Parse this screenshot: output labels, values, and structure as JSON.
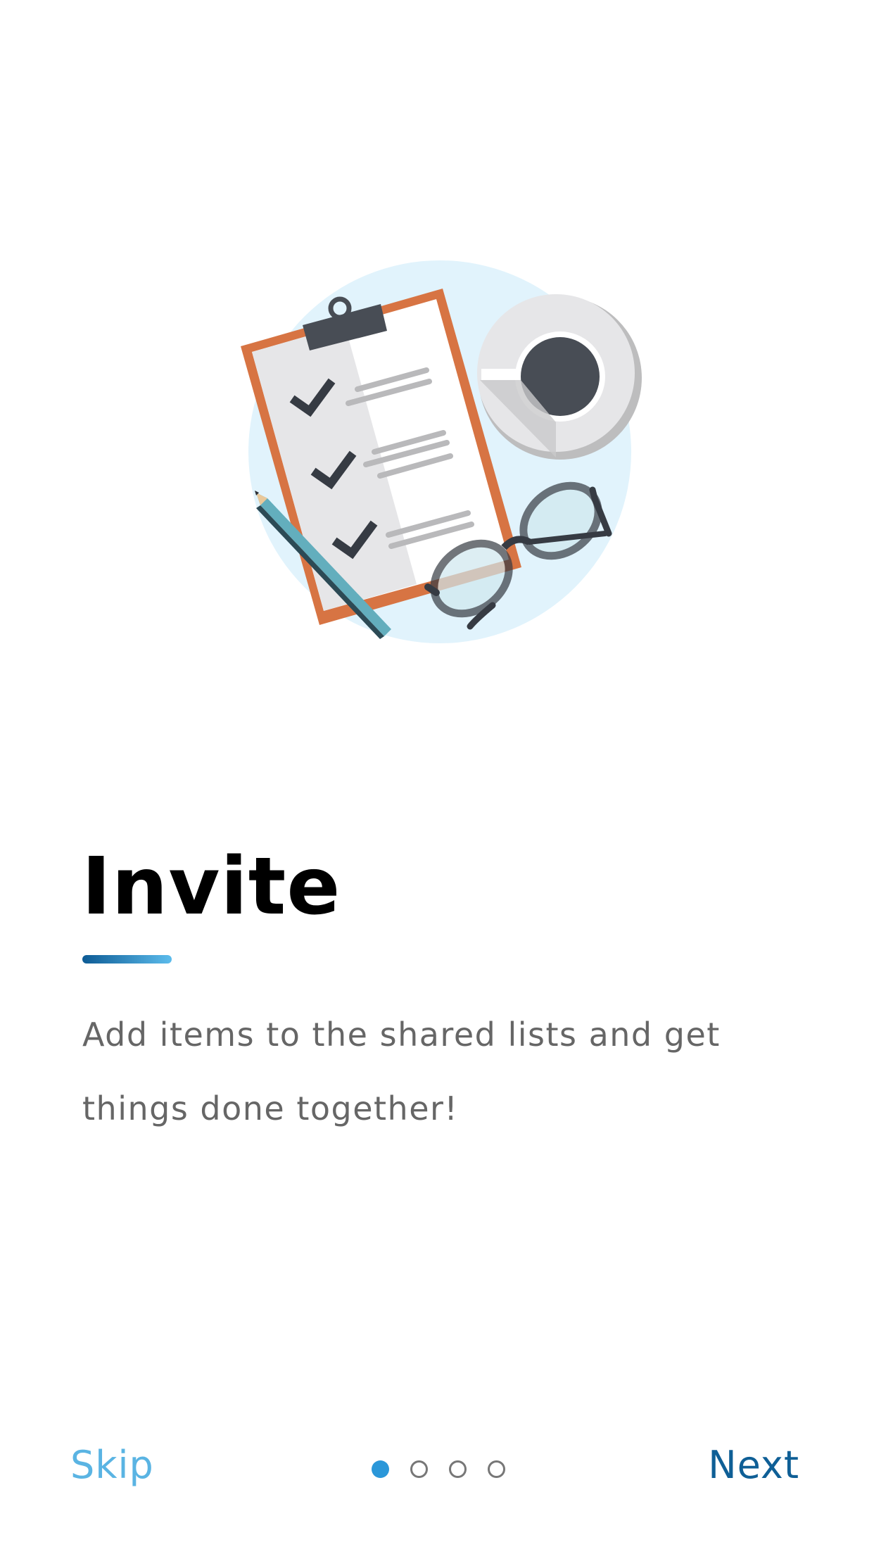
{
  "onboarding": {
    "title": "Invite",
    "description_line1": "Add items to the shared lists and get",
    "description_line2": "things done together!",
    "skip_label": "Skip",
    "next_label": "Next",
    "pager": {
      "total_pages": 4,
      "current_page": 1
    }
  },
  "illustration": {
    "subject": "clipboard-checklist-with-coffee-and-glasses",
    "checked_items": 3
  },
  "colors": {
    "accent_primary": "#2b97d9",
    "skip_text": "#5ab4e3",
    "next_text": "#0f5f96",
    "title_text": "#000000",
    "body_text": "#666666",
    "clipboard_border": "#d77443",
    "illustration_bg": "#e1f3fc"
  }
}
